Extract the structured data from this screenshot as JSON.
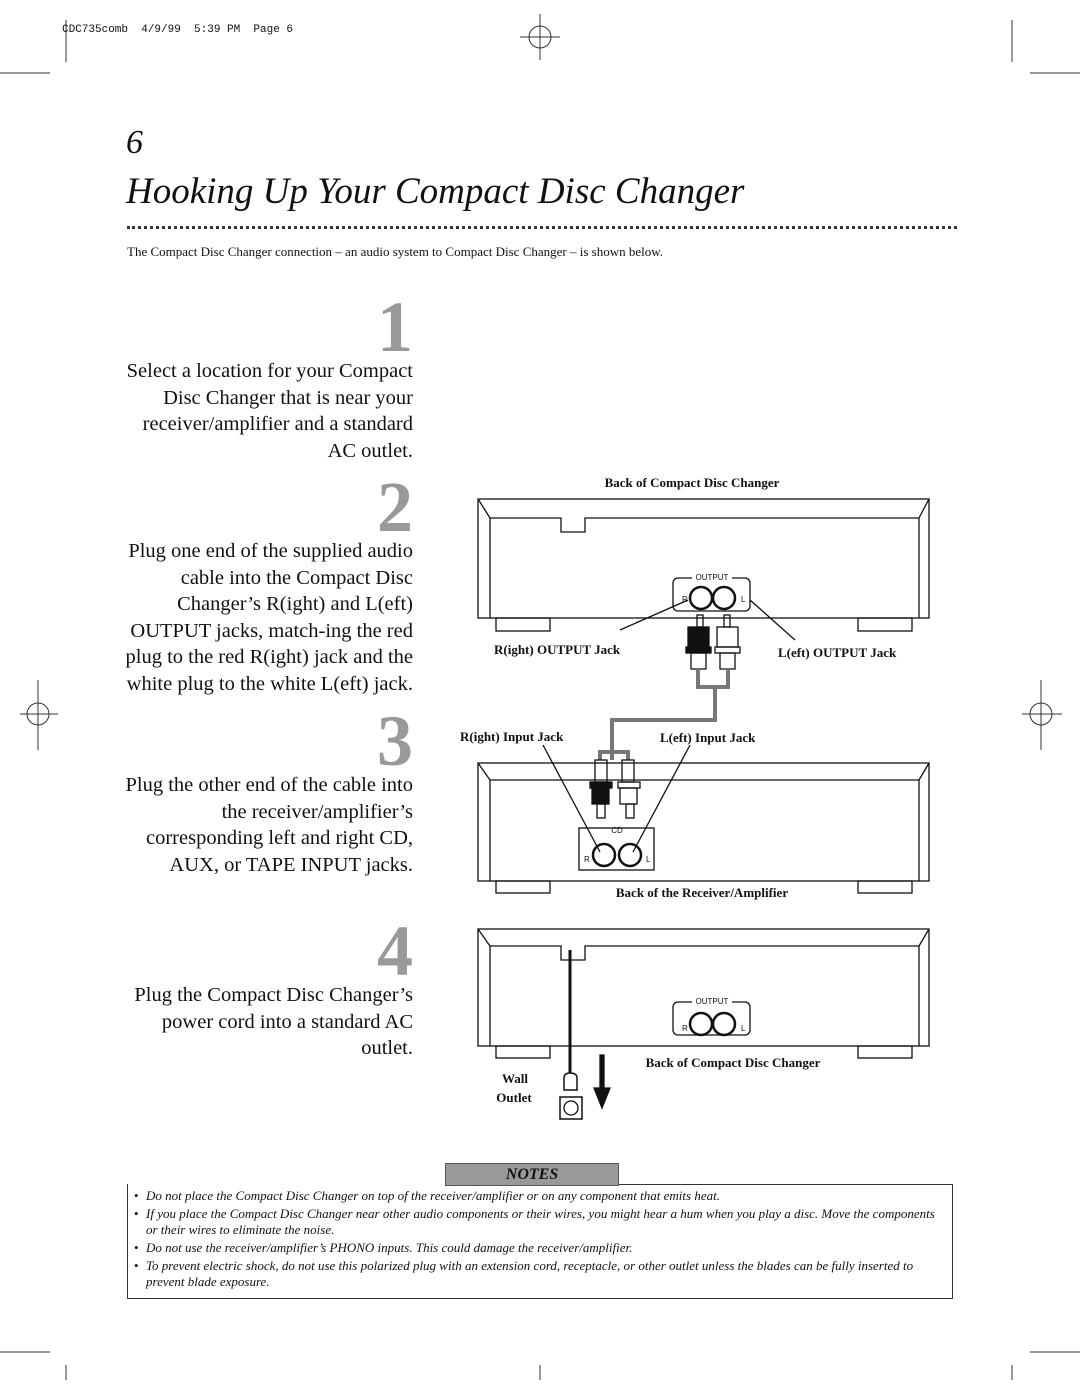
{
  "slug": "CDC735comb  4/9/99  5:39 PM  Page 6",
  "page_number": "6",
  "title": "Hooking Up Your Compact Disc Changer",
  "intro": "The Compact Disc Changer connection – an audio system to Compact Disc Changer – is shown below.",
  "steps": [
    {
      "number": "1",
      "text": "Select a location for your Compact Disc Changer that is near your receiver/amplifier and a standard AC outlet."
    },
    {
      "number": "2",
      "text": "Plug one end of the supplied audio cable into the Compact Disc Changer’s R(ight) and L(eft) OUTPUT jacks, match-ing the red plug to the red R(ight) jack and the white plug to the white L(eft) jack."
    },
    {
      "number": "3",
      "text": "Plug the other end of the cable into the receiver/amplifier’s corresponding left and right CD, AUX, or TAPE INPUT jacks."
    },
    {
      "number": "4",
      "text": "Plug the Compact Disc Changer’s power cord into a standard AC outlet."
    }
  ],
  "diagram": {
    "back_changer_top": "Back of Compact Disc Changer",
    "output": "OUTPUT",
    "r": "R",
    "l": "L",
    "cd": "CD",
    "right_output_jack": "R(ight) OUTPUT Jack",
    "left_output_jack": "L(eft) OUTPUT Jack",
    "right_input_jack": "R(ight) Input Jack",
    "left_input_jack": "L(eft) Input Jack",
    "back_receiver": "Back of the Receiver/Amplifier",
    "back_changer_bottom": "Back of Compact Disc Changer",
    "wall": "Wall",
    "outlet": "Outlet"
  },
  "notes": {
    "heading": "NOTES",
    "items": [
      "Do not place the Compact Disc Changer on top of the receiver/amplifier or on any component that emits heat.",
      "If you place the Compact Disc Changer near other audio components or their wires, you might hear a hum when you play a disc.  Move the components or their wires to eliminate the noise.",
      "Do not use the receiver/amplifier’s PHONO inputs.  This could damage the receiver/amplifier.",
      "To prevent electric shock, do not use this polarized plug with an extension cord, receptacle, or other outlet unless the blades can be fully inserted to prevent blade exposure."
    ]
  }
}
